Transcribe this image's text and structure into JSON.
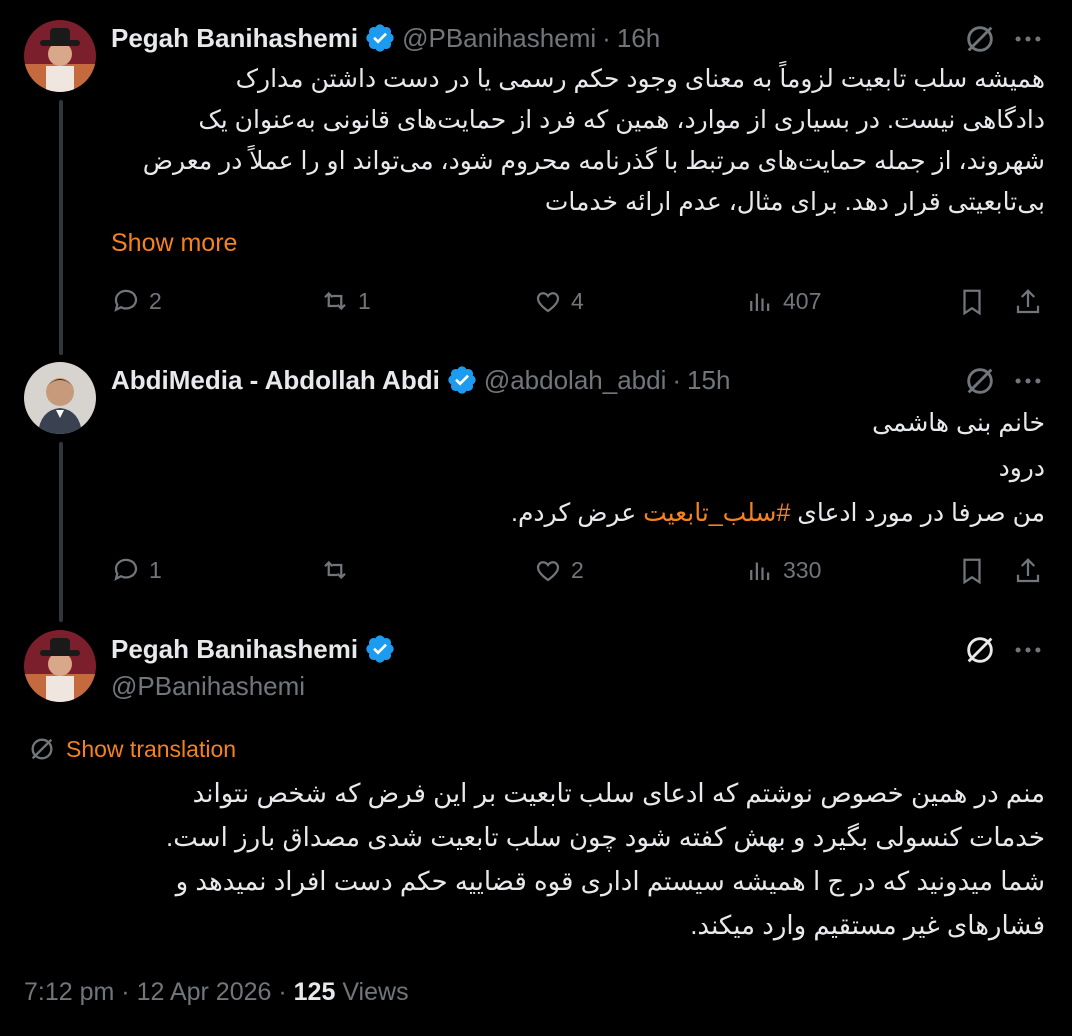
{
  "tweets": [
    {
      "name": "Pegah Banihashemi",
      "handle": "@PBanihashemi",
      "time": "16h",
      "body_lines": [
        "همیشه سلب تابعیت لزوماً به معنای وجود حکم رسمی یا در دست داشتن مدارک",
        "دادگاهی نیست. در بسیاری از موارد، همین که فرد از حمایت‌های قانونی به‌عنوان یک",
        "شهروند، از جمله حمایت‌های مرتبط با گذرنامه محروم شود، می‌تواند او را عملاً در معرض",
        "بی‌تابعیتی قرار دهد. برای مثال، عدم ارائه خدمات"
      ],
      "show_more": "Show more",
      "replies": "2",
      "reposts": "1",
      "likes": "4",
      "views": "407"
    },
    {
      "name": "AbdiMedia - Abdollah Abdi",
      "handle": "@abdolah_abdi",
      "time": "15h",
      "line1": "خانم بنی هاشمی",
      "line2": "درود",
      "line3_before": "من صرفا در مورد ادعای ",
      "hashtag": "#سلب_تابعیت",
      "line3_after": " عرض کردم.",
      "replies": "1",
      "reposts": "",
      "likes": "2",
      "views": "330"
    }
  ],
  "main": {
    "name": "Pegah Banihashemi",
    "handle": "@PBanihashemi",
    "show_translation": "Show translation",
    "body_lines": [
      "منم در همین خصوص نوشتم که ادعای سلب تابعیت بر این فرض که شخص نتواند",
      "خدمات کنسولی بگیرد و بهش کفته شود چون سلب تابعیت شدی مصداق بارز است.",
      "شما میدونید که در ج ا همیشه سیستم اداری قوه قضاییه حکم دست افراد نمیدهد و",
      "فشارهای غیر مستقیم وارد میکند."
    ],
    "time": "7:12 pm",
    "date": "12 Apr 2026",
    "views_count": "125",
    "views_label": "Views"
  },
  "colors": {
    "accent": "#f5821f",
    "verified": "#1d9bf0",
    "muted": "#71767b"
  }
}
